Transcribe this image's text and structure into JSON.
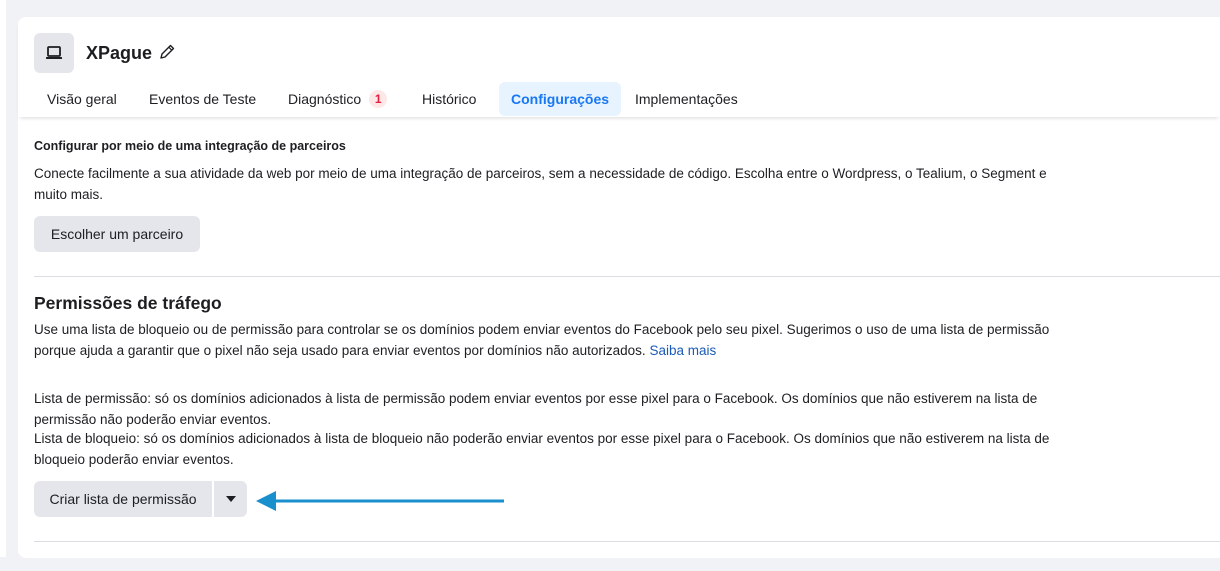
{
  "app": {
    "title": "XPague",
    "icon": "laptop-icon",
    "edit_icon": "pencil-icon"
  },
  "tabs": [
    {
      "label": "Visão geral"
    },
    {
      "label": "Eventos de Teste"
    },
    {
      "label": "Diagnóstico",
      "badge": "1"
    },
    {
      "label": "Histórico"
    },
    {
      "label": "Configurações",
      "active": true
    },
    {
      "label": "Implementações"
    }
  ],
  "partner": {
    "heading": "Configurar por meio de uma integração de parceiros",
    "description": "Conecte facilmente a sua atividade da web por meio de uma integração de parceiros, sem a necessidade de código. Escolha entre o Wordpress, o Tealium, o Segment e muito mais.",
    "button_label": "Escolher um parceiro"
  },
  "traffic": {
    "heading": "Permissões de tráfego",
    "description": "Use uma lista de bloqueio ou de permissão para controlar se os domínios podem enviar eventos do Facebook pelo seu pixel. Sugerimos o uso de uma lista de permissão porque ajuda a garantir que o pixel não seja usado para enviar eventos por domínios não autorizados.",
    "learn_more": "Saiba mais",
    "allowlist_text": "Lista de permissão: só os domínios adicionados à lista de permissão podem enviar eventos por esse pixel para o Facebook. Os domínios que não estiverem na lista de permissão não poderão enviar eventos.",
    "blocklist_text": "Lista de bloqueio: só os domínios adicionados à lista de bloqueio não poderão enviar eventos por esse pixel para o Facebook. Os domínios que não estiverem na lista de bloqueio poderão enviar eventos.",
    "create_button_label": "Criar lista de permissão",
    "dropdown_icon": "caret-down-icon"
  },
  "annotation": {
    "arrow_color": "#1a8fce"
  },
  "colors": {
    "accent": "#1877f2",
    "link": "#1a5bb8",
    "badge_bg": "#fde7e7",
    "badge_text": "#e41e3f"
  }
}
